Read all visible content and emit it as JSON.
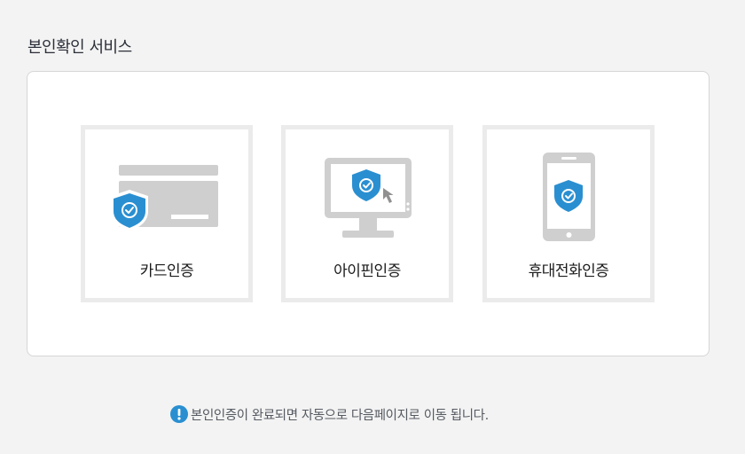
{
  "section": {
    "title": "본인확인 서비스"
  },
  "options": [
    {
      "label": "카드인증",
      "icon": "credit-card-shield-icon"
    },
    {
      "label": "아이핀인증",
      "icon": "monitor-shield-cursor-icon"
    },
    {
      "label": "휴대전화인증",
      "icon": "mobile-phone-shield-icon"
    }
  ],
  "notice": {
    "icon": "exclamation-circle-icon",
    "text": "본인인증이 완료되면 자동으로 다음페이지로 이동 됩니다."
  },
  "colors": {
    "accent": "#2a8fd1",
    "icon_gray": "#cfcfcf",
    "tile_border": "#ebebeb",
    "background": "#f3f3f3"
  }
}
